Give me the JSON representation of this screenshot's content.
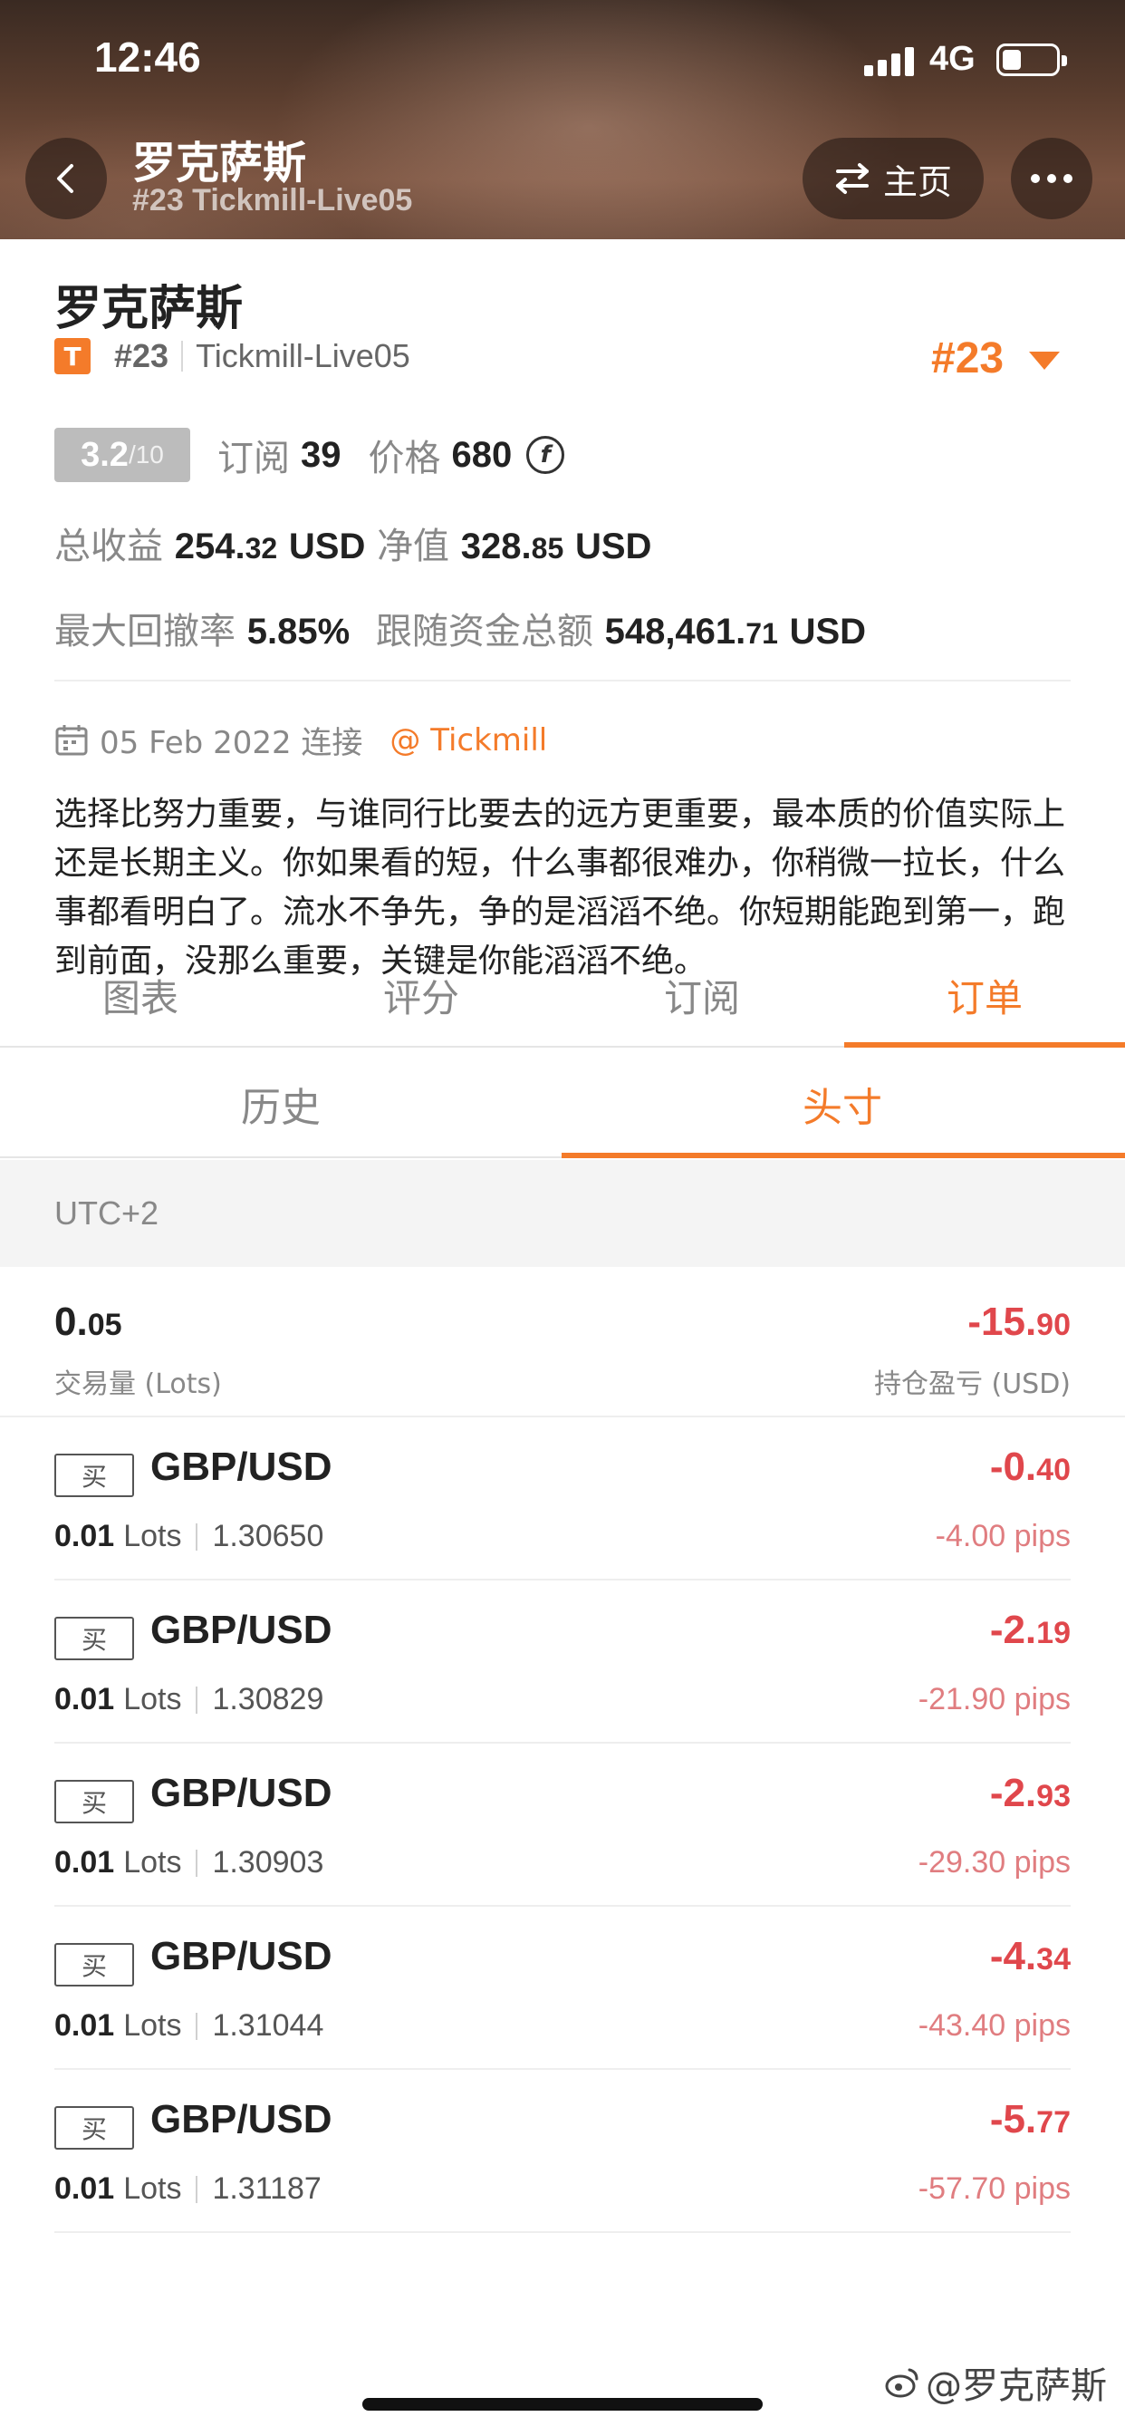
{
  "status_bar": {
    "time": "12:46",
    "network": "4G"
  },
  "header": {
    "title": "罗克萨斯",
    "subtitle": "#23 Tickmill-Live05",
    "home_label": "主页"
  },
  "profile": {
    "name": "罗克萨斯",
    "badge_letter": "T",
    "rank_small": "#23",
    "server": "Tickmill-Live05",
    "rank_big": "#23",
    "rating_main": "3.2",
    "rating_max": "/10",
    "subscribe_label": "订阅",
    "subscribe_count": "39",
    "price_label": "价格",
    "price_value": "680",
    "total_profit_label": "总收益",
    "total_profit_int": "254.",
    "total_profit_dec": "32",
    "total_profit_unit": "USD",
    "net_value_label": "净值",
    "net_value_int": "328.",
    "net_value_dec": "85",
    "net_value_unit": "USD",
    "max_drawdown_label": "最大回撤率",
    "max_drawdown_value": "5.85%",
    "follow_total_label": "跟随资金总额",
    "follow_total_int": "548,461.",
    "follow_total_dec": "71",
    "follow_total_unit": "USD",
    "connect_date": "05 Feb 2022 连接",
    "broker_link": "@ Tickmill",
    "bio": "选择比努力重要，与谁同行比要去的远方更重要，最本质的价值实际上还是长期主义。你如果看的短，什么事都很难办，你稍微一拉长，什么事都看明白了。流水不争先，争的是滔滔不绝。你短期能跑到第一，跑到前面，没那么重要，关键是你能滔滔不绝。"
  },
  "tabs": [
    "图表",
    "评分",
    "订阅",
    "订单"
  ],
  "subtabs": [
    "历史",
    "头寸"
  ],
  "timezone": "UTC+2",
  "summary": {
    "volume_int": "0.",
    "volume_dec": "05",
    "volume_label": "交易量 (Lots)",
    "pl_int": "-15.",
    "pl_dec": "90",
    "pl_label": "持仓盈亏 (USD)"
  },
  "orders": [
    {
      "side": "买",
      "pair": "GBP/USD",
      "lots": "0.01",
      "lots_unit": "Lots",
      "price": "1.30650",
      "pl_int": "-0.",
      "pl_dec": "40",
      "pips": "-4.00 pips"
    },
    {
      "side": "买",
      "pair": "GBP/USD",
      "lots": "0.01",
      "lots_unit": "Lots",
      "price": "1.30829",
      "pl_int": "-2.",
      "pl_dec": "19",
      "pips": "-21.90 pips"
    },
    {
      "side": "买",
      "pair": "GBP/USD",
      "lots": "0.01",
      "lots_unit": "Lots",
      "price": "1.30903",
      "pl_int": "-2.",
      "pl_dec": "93",
      "pips": "-29.30 pips"
    },
    {
      "side": "买",
      "pair": "GBP/USD",
      "lots": "0.01",
      "lots_unit": "Lots",
      "price": "1.31044",
      "pl_int": "-4.",
      "pl_dec": "34",
      "pips": "-43.40 pips"
    },
    {
      "side": "买",
      "pair": "GBP/USD",
      "lots": "0.01",
      "lots_unit": "Lots",
      "price": "1.31187",
      "pl_int": "-5.",
      "pl_dec": "77",
      "pips": "-57.70 pips"
    }
  ],
  "watermark": "@罗克萨斯",
  "colors": {
    "accent": "#f47b2a",
    "loss": "#e0474c",
    "loss_light": "#e07d80"
  }
}
